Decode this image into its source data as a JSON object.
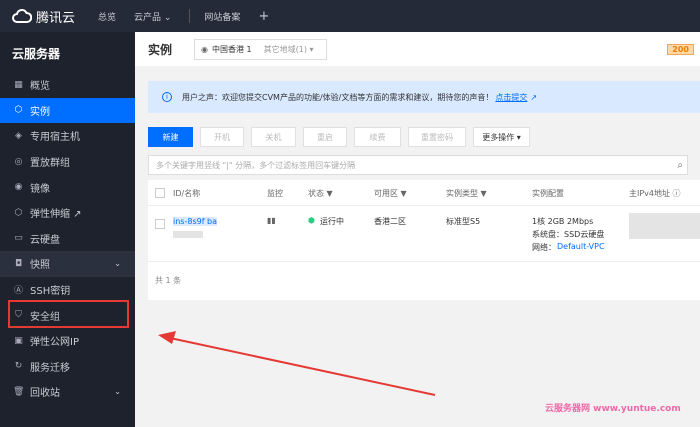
{
  "topbar": {
    "brand": "腾讯云",
    "nav": [
      "总览",
      "云产品 ⌄",
      "网站备案",
      "+"
    ]
  },
  "sidebar": {
    "title": "云服务器",
    "items": [
      {
        "label": "概览",
        "icon": "grid-icon"
      },
      {
        "label": "实例",
        "icon": "cube-icon",
        "active": true
      },
      {
        "label": "专用宿主机",
        "icon": "layers-icon"
      },
      {
        "label": "置放群组",
        "icon": "group-icon"
      },
      {
        "label": "镜像",
        "icon": "disc-icon"
      },
      {
        "label": "弹性伸缩 ↗",
        "icon": "scale-icon"
      },
      {
        "label": "云硬盘",
        "icon": "disk-icon"
      },
      {
        "label": "快照",
        "icon": "camera-icon",
        "expandable": true
      },
      {
        "label": "SSH密钥",
        "icon": "key-icon"
      },
      {
        "label": "安全组",
        "icon": "shield-icon"
      },
      {
        "label": "弹性公网IP",
        "icon": "ip-icon"
      },
      {
        "label": "服务迁移",
        "icon": "migrate-icon"
      },
      {
        "label": "回收站",
        "icon": "trash-icon",
        "expandable": true
      }
    ]
  },
  "header": {
    "title": "实例",
    "region": "中国香港 1",
    "other_regions": "其它地域(1) ▾",
    "badge": "200"
  },
  "notice": {
    "text": "用户之声：欢迎您提交CVM产品的功能/体验/文档等方面的需求和建议，期待您的声音！",
    "link": "点击提交"
  },
  "toolbar": {
    "buttons": [
      "新建",
      "开机",
      "关机",
      "重启",
      "续费",
      "重置密码",
      "更多操作 ▾"
    ]
  },
  "search": {
    "placeholder": "多个关键字用竖线 \"|\" 分隔，多个过滤标签用回车键分隔"
  },
  "table": {
    "columns": [
      "ID/名称",
      "监控",
      "状态 ▼",
      "可用区 ▼",
      "实例类型 ▼",
      "实例配置",
      "主IPv4地址 ⓘ"
    ],
    "rows": [
      {
        "id": "ins-8s9f ba",
        "status": "运行中",
        "zone": "香港二区",
        "type": "标准型S5",
        "config": [
          "1核 2GB 2Mbps",
          "系统盘：SSD云硬盘",
          "网络："
        ],
        "vpc": "Default-VPC"
      }
    ],
    "total": "共 1 条"
  },
  "watermark": "云服务器网 www.yuntue.com",
  "colors": {
    "accent": "#006eff",
    "highlight": "#e53935",
    "running": "#29cc85"
  }
}
